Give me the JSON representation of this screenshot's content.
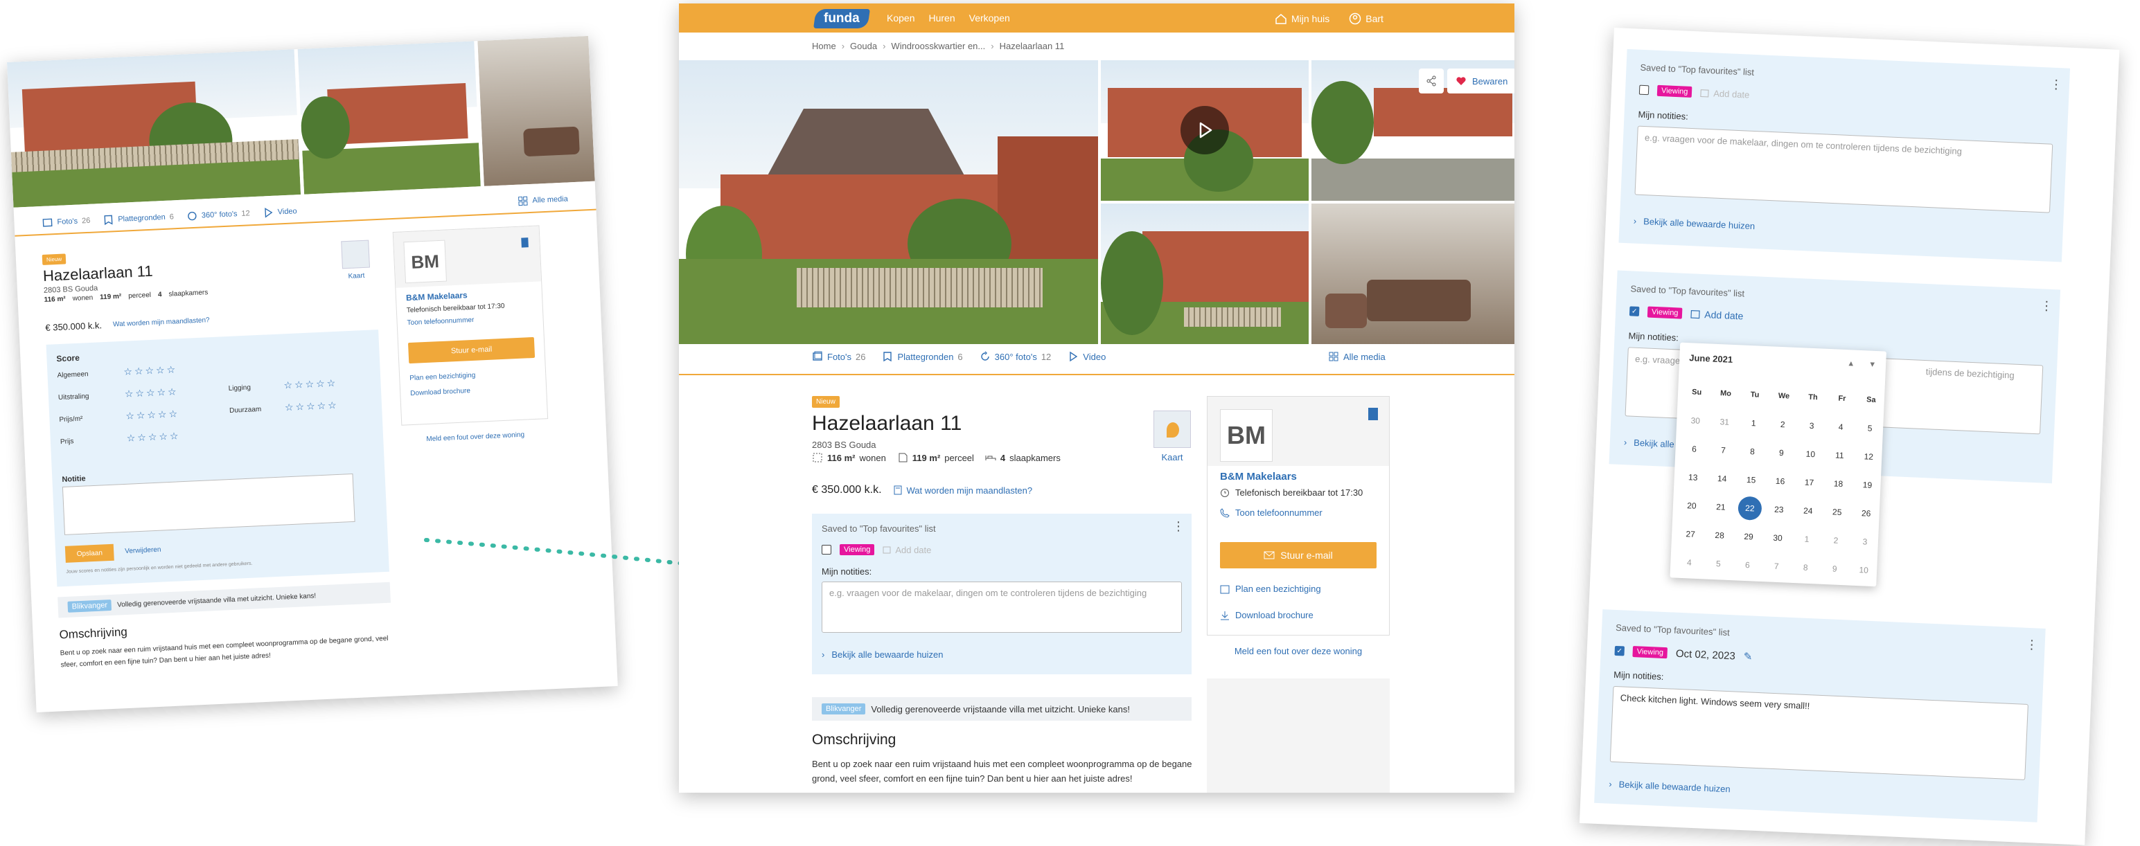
{
  "nav": {
    "logo": "funda",
    "links": [
      "Kopen",
      "Huren",
      "Verkopen"
    ],
    "mijn_huis": "Mijn huis",
    "user": "Bart"
  },
  "breadcrumb": [
    "Home",
    "Gouda",
    "Windroosskwartier en...",
    "Hazelaarlaan 11"
  ],
  "gallery": {
    "bewaren": "Bewaren"
  },
  "media": {
    "fotos": "Foto's",
    "fotos_count": "26",
    "plattegronden": "Plattegronden",
    "plattegronden_count": "6",
    "fotos360": "360° foto's",
    "fotos360_count": "12",
    "video": "Video",
    "alle_media": "Alle media"
  },
  "listing": {
    "badge": "Nieuw",
    "title": "Hazelaarlaan 11",
    "address": "2803 BS Gouda",
    "wonen": "116 m²",
    "wonen_label": "wonen",
    "perceel": "119 m²",
    "perceel_label": "perceel",
    "slaapkamers": "4",
    "slaapkamers_label": "slaapkamers",
    "price": "€ 350.000 k.k.",
    "maandlasten": "Wat worden mijn maandlasten?",
    "kaart": "Kaart"
  },
  "notes_center": {
    "saved": "Saved to \"Top favourites\" list",
    "viewing": "Viewing",
    "add_date": "Add date",
    "label": "Mijn notities:",
    "placeholder": "e.g. vraagen voor de makelaar, dingen om te controleren tijdens de bezichtiging",
    "link": "Bekijk alle bewaarde huizen"
  },
  "billion": {
    "tag": "Blikvanger",
    "text": "Volledig gerenoveerde vrijstaande villa met uitzicht. Unieke kans!"
  },
  "description": {
    "heading": "Omschrijving",
    "text": "Bent u op zoek naar een ruim vrijstaand huis met een compleet woonprogramma op de begane grond, veel sfeer, comfort en een fijne tuin? Dan bent u hier aan het juiste adres!"
  },
  "agent": {
    "logo": "BM",
    "name": "B&M Makelaars",
    "phone_hours": "Telefonisch bereikbaar tot 17:30",
    "phone_link": "Toon telefoonnummer",
    "email_btn": "Stuur e-mail",
    "plan": "Plan een bezichtiging",
    "brochure": "Download brochure",
    "meld": "Meld een fout over deze woning"
  },
  "left_page": {
    "score_title": "Score",
    "score_rows": [
      "Algemeen",
      "Uitstraling",
      "Prijs/m²",
      "Prijs"
    ],
    "score_rows_right": [
      "Ligging",
      "Duurzaam"
    ],
    "notitie": "Notitie",
    "opslaan": "Opslaan",
    "verwijderen": "Verwijderen",
    "footnote": "Jouw scores en notities zijn persoonlijk en worden niet gedeeld met andere gebruikers.",
    "agent_email": "Stuur e-mail"
  },
  "right_page": {
    "saved": "Saved to \"Top favourites\" list",
    "viewing": "Viewing",
    "add_date": "Add date",
    "label": "Mijn notities:",
    "placeholder": "e.g. vraagen voor de makelaar, dingen om te controleren tijdens de bezichtiging",
    "placeholder_short": "e.g. vraagen",
    "placeholder_rest": "tijdens de bezichtiging",
    "link": "Bekijk alle bewaarde huizen",
    "link_short": "Bekijk alle",
    "date_value": "Oct 02, 2023",
    "filled_note": "Check kitchen light. Windows seem very small!!",
    "calendar": {
      "month": "June 2021",
      "dow": [
        "Su",
        "Mo",
        "Tu",
        "We",
        "Th",
        "Fr",
        "Sa"
      ],
      "weeks": [
        [
          "30",
          "31",
          "1",
          "2",
          "3",
          "4",
          "5"
        ],
        [
          "6",
          "7",
          "8",
          "9",
          "10",
          "11",
          "12"
        ],
        [
          "13",
          "14",
          "15",
          "16",
          "17",
          "18",
          "19"
        ],
        [
          "20",
          "21",
          "22",
          "23",
          "24",
          "25",
          "26"
        ],
        [
          "27",
          "28",
          "29",
          "30",
          "1",
          "2",
          "3"
        ],
        [
          "4",
          "5",
          "6",
          "7",
          "8",
          "9",
          "10"
        ]
      ],
      "selected": "22"
    }
  },
  "colors": {
    "brand_orange": "#f0a83a",
    "brand_blue": "#2f6fb4",
    "viewing_pink": "#e6169d",
    "notes_bg": "#e6f2fb"
  }
}
